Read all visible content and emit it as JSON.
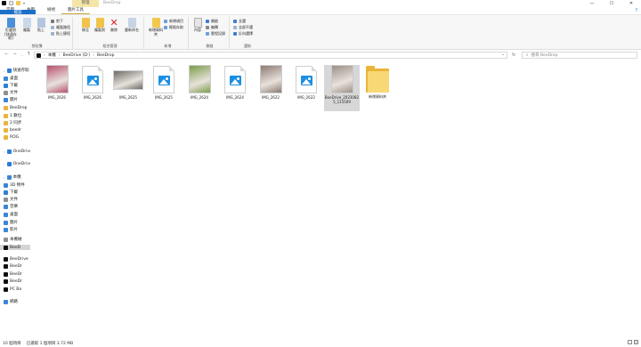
{
  "window": {
    "title": "BeeDrop",
    "context_tab": "管理",
    "controls": [
      "—",
      "☐",
      "✕"
    ]
  },
  "ribbon_tabs": {
    "file": "檔案",
    "home": "常用",
    "share": "共用",
    "view": "檢視",
    "picture_tools": "圖片工具"
  },
  "ribbon": {
    "clipboard": {
      "pin": "釘選到[快速存取]",
      "copy": "複製",
      "paste": "貼上",
      "cut": "剪下",
      "copy_path": "複製路徑",
      "paste_shortcut": "貼上捷徑",
      "label": "剪貼簿"
    },
    "organize": {
      "move_to": "移至",
      "copy_to": "複製到",
      "delete": "刪除",
      "rename": "重新命名",
      "label": "組合管理"
    },
    "new": {
      "new_folder": "新增資料夾",
      "new_item": "新增項目",
      "easy_access": "輕鬆存取",
      "label": "新增"
    },
    "open": {
      "properties": "內容",
      "open": "開啟",
      "edit": "編輯",
      "history": "歷程記錄",
      "label": "開啟"
    },
    "select": {
      "select_all": "全選",
      "select_none": "全部不選",
      "invert": "反向選擇",
      "label": "選取"
    }
  },
  "address_bar": {
    "crumbs": [
      "本機",
      "BeeDrive (D:)",
      "BeeDrop"
    ],
    "search_placeholder": "搜尋 BeeDrop"
  },
  "nav_pane": {
    "items": [
      {
        "label": "快速存取",
        "color": "#2b7bd8"
      },
      {
        "label": "桌面",
        "color": "#3a86d6"
      },
      {
        "label": "下載",
        "color": "#2f7fd4"
      },
      {
        "label": "文件",
        "color": "#8f8f8f"
      },
      {
        "label": "圖片",
        "color": "#3a86d6"
      },
      {
        "label": "BeeDrop",
        "color": "#e9b53a"
      },
      {
        "label": "1 數位",
        "color": "#e9b53a"
      },
      {
        "label": "2 同步",
        "color": "#e9b53a"
      },
      {
        "label": "beedr",
        "color": "#e9b53a"
      },
      {
        "label": "ROG",
        "color": "#e9b53a"
      },
      {
        "label": "OneDrive",
        "color": "#2b7bd8"
      },
      {
        "label": "OneDrive",
        "color": "#2b7bd8"
      },
      {
        "label": "本機",
        "color": "#3a86d6"
      },
      {
        "label": "3D 物件",
        "color": "#3a86d6"
      },
      {
        "label": "下載",
        "color": "#2f7fd4"
      },
      {
        "label": "文件",
        "color": "#8f8f8f"
      },
      {
        "label": "音樂",
        "color": "#3a86d6"
      },
      {
        "label": "桌面",
        "color": "#3a86d6"
      },
      {
        "label": "圖片",
        "color": "#3a86d6"
      },
      {
        "label": "影片",
        "color": "#3a86d6"
      },
      {
        "label": "本機磁",
        "color": "#8f8f8f"
      },
      {
        "label": "BeeD",
        "color": "#111111"
      },
      {
        "label": "BeeDrive",
        "color": "#111111"
      },
      {
        "label": "BeeDr",
        "color": "#111111"
      },
      {
        "label": "BeeDr",
        "color": "#111111"
      },
      {
        "label": "BeeDr",
        "color": "#111111"
      },
      {
        "label": "PC Ba",
        "color": "#111111"
      },
      {
        "label": "網路",
        "color": "#3a86d6"
      }
    ]
  },
  "files": [
    {
      "name": "IMG_2626",
      "kind": "photo",
      "color": "#b8526e"
    },
    {
      "name": "IMG_2626",
      "kind": "generic"
    },
    {
      "name": "IMG_2625",
      "kind": "photo",
      "color": "#6f6a66"
    },
    {
      "name": "IMG_2625",
      "kind": "generic"
    },
    {
      "name": "IMG_2624",
      "kind": "photo",
      "color": "#7b9d4a"
    },
    {
      "name": "IMG_2624",
      "kind": "generic"
    },
    {
      "name": "IMG_2622",
      "kind": "photo",
      "color": "#8c7a73"
    },
    {
      "name": "IMG_2622",
      "kind": "generic"
    },
    {
      "name": "BeeDrive_20230825_115509",
      "kind": "photo",
      "color": "#9a8f84",
      "selected": true
    },
    {
      "name": "新增資料夾",
      "kind": "folder"
    }
  ],
  "status_bar": {
    "count": "10 個項目",
    "selection": "已選取 1 個項目  3.72 MB"
  }
}
